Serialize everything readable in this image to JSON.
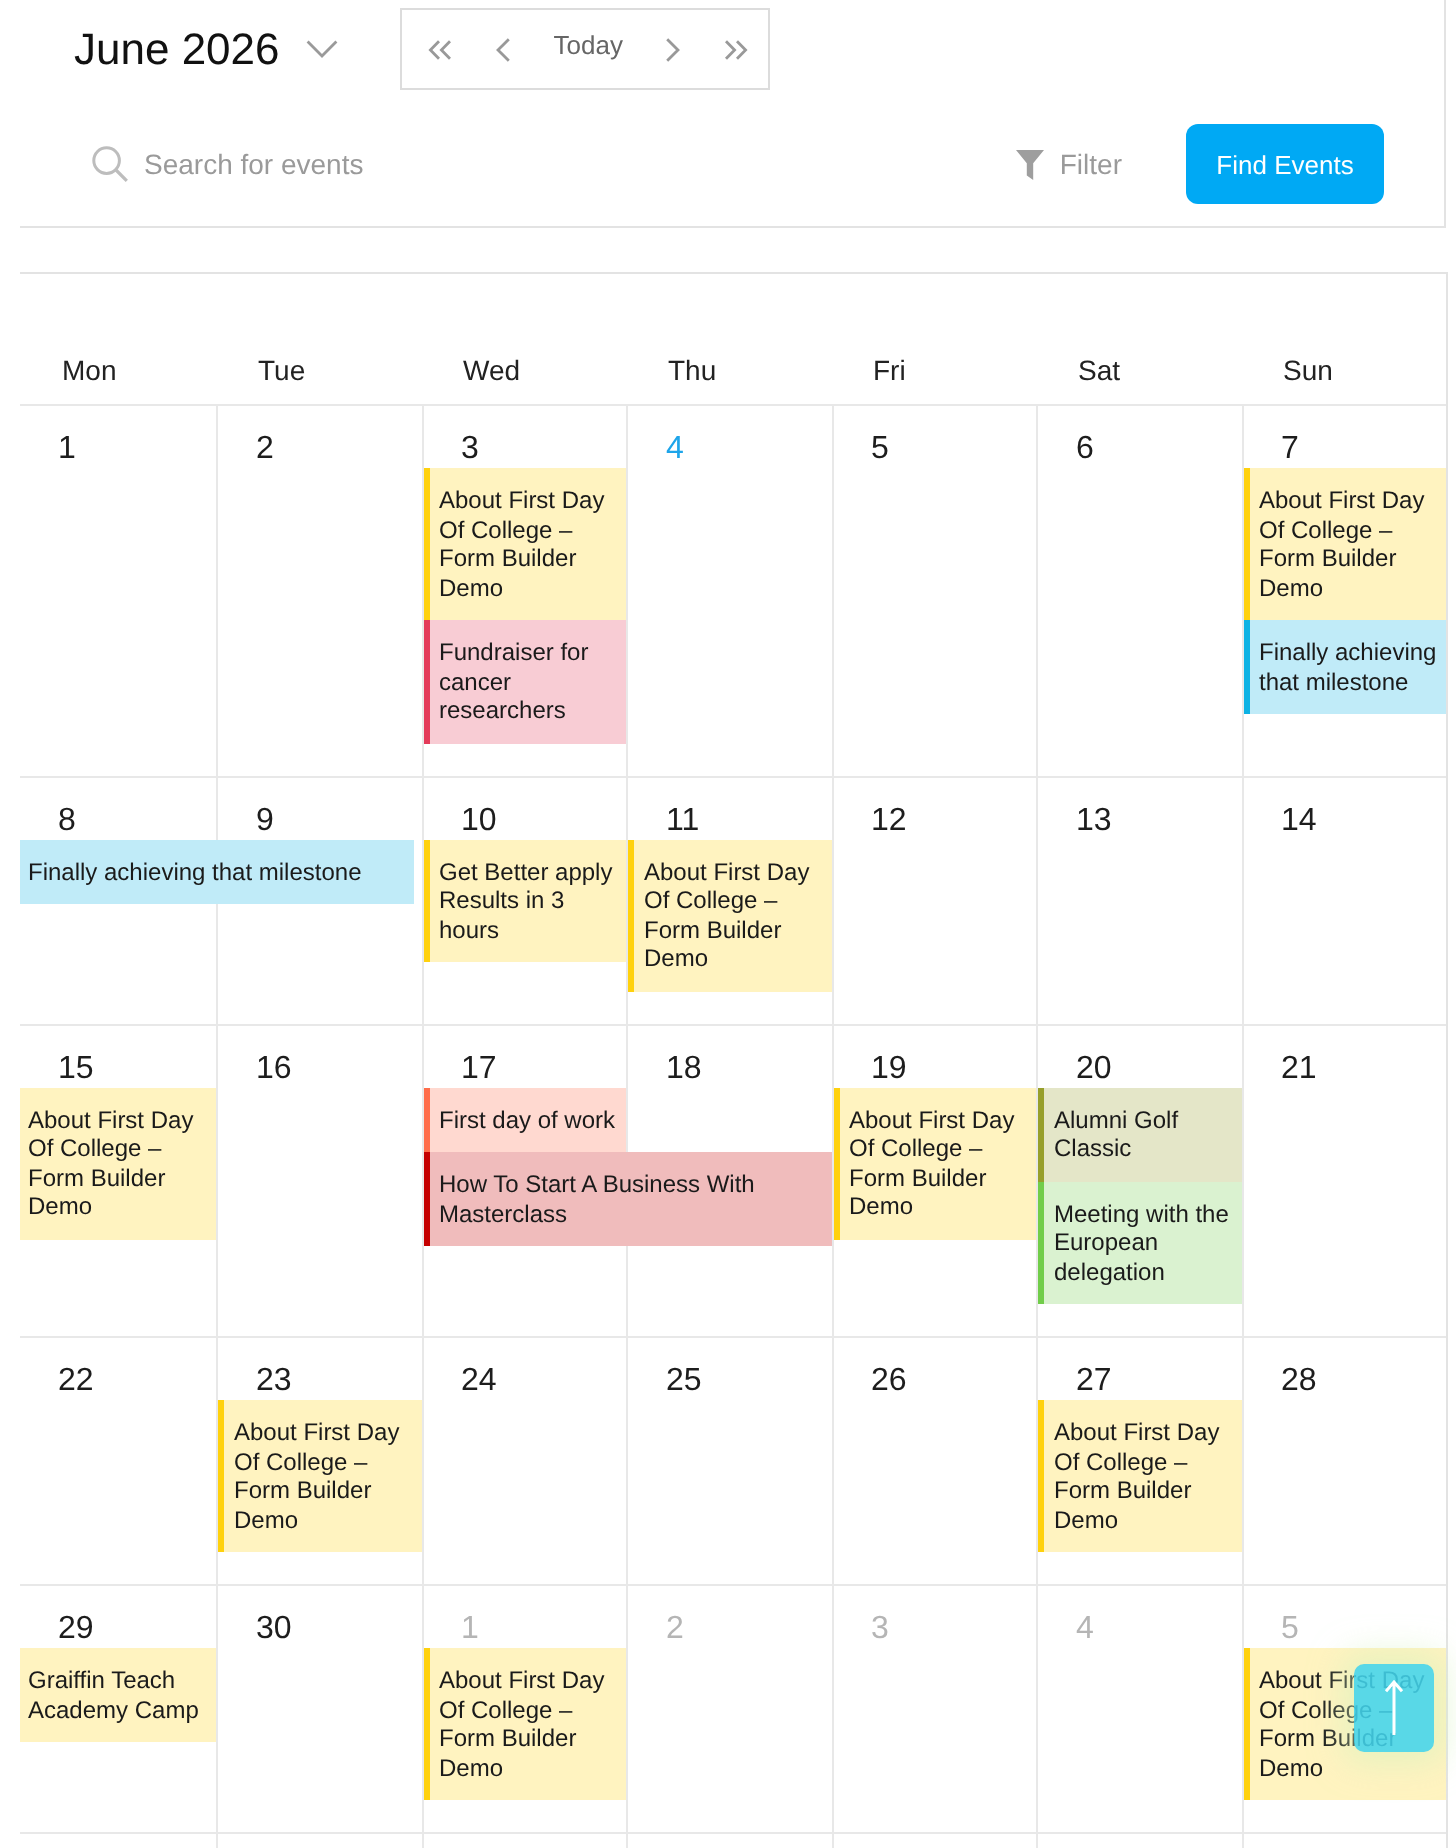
{
  "header": {
    "month_label": "June 2026",
    "today_button": "Today",
    "search": {
      "placeholder": "Search for events"
    },
    "filter_label": "Filter",
    "find_button": "Find Events"
  },
  "calendar": {
    "weekdays": [
      "Mon",
      "Tue",
      "Wed",
      "Thu",
      "Fri",
      "Sat",
      "Sun"
    ],
    "weeks": [
      {
        "days": [
          {
            "number": "1",
            "kind": "in-month"
          },
          {
            "number": "2",
            "kind": "in-month"
          },
          {
            "number": "3",
            "kind": "in-month",
            "events": [
              {
                "title": "About First Day Of College – Form Builder Demo",
                "color": "#fff3c0",
                "kind": "single-day"
              },
              {
                "title": "Fundraiser for cancer researchers",
                "color": "#f8ccd4",
                "kind": "single-day"
              }
            ]
          },
          {
            "number": "4",
            "kind": "today"
          },
          {
            "number": "5",
            "kind": "in-month"
          },
          {
            "number": "6",
            "kind": "in-month"
          },
          {
            "number": "7",
            "kind": "in-month",
            "events": [
              {
                "title": "About First Day Of College – Form Builder Demo",
                "color": "#fff3c0",
                "kind": "single-day"
              },
              {
                "title": "Finally achieving that milestone",
                "color": "#c0ebf8",
                "kind": "single-day"
              }
            ]
          }
        ]
      },
      {
        "days": [
          {
            "number": "8",
            "kind": "in-month",
            "events": [
              {
                "title": "Finally achieving that milestone",
                "color": "#c0ebf8",
                "kind": "two-day"
              }
            ]
          },
          {
            "number": "9",
            "kind": "in-month"
          },
          {
            "number": "10",
            "kind": "in-month",
            "events": [
              {
                "title": "Get Better apply Results in 3 hours",
                "color": "#fff3c0",
                "kind": "single-day"
              }
            ]
          },
          {
            "number": "11",
            "kind": "in-month",
            "events": [
              {
                "title": "About First Day Of College – Form Builder Demo",
                "color": "#fff3c0",
                "kind": "single-day"
              }
            ]
          },
          {
            "number": "12",
            "kind": "in-month"
          },
          {
            "number": "13",
            "kind": "in-month"
          },
          {
            "number": "14",
            "kind": "in-month"
          }
        ]
      },
      {
        "days": [
          {
            "number": "15",
            "kind": "in-month",
            "events": [
              {
                "title": "About First Day Of College – Form Builder Demo",
                "color": "#fff3c0",
                "kind": "single-day"
              }
            ]
          },
          {
            "number": "16",
            "kind": "in-month"
          },
          {
            "number": "17",
            "kind": "in-month",
            "events": [
              {
                "title": "First day of work",
                "color": "#ffd9d0",
                "kind": "single-day"
              },
              {
                "title": "How To Start A Business With Masterclass",
                "color": "#f0bcbc",
                "kind": "two-day"
              }
            ]
          },
          {
            "number": "18",
            "kind": "in-month"
          },
          {
            "number": "19",
            "kind": "in-month",
            "events": [
              {
                "title": "About First Day Of College – Form Builder Demo",
                "color": "#fff3c0",
                "kind": "single-day"
              }
            ]
          },
          {
            "number": "20",
            "kind": "in-month",
            "events": [
              {
                "title": "Alumni Golf Classic",
                "color": "#e4e6c8",
                "kind": "single-day"
              },
              {
                "title": "Meeting with the European delegation",
                "color": "#daf2d0",
                "kind": "single-day"
              }
            ]
          },
          {
            "number": "21",
            "kind": "in-month"
          }
        ]
      },
      {
        "days": [
          {
            "number": "22",
            "kind": "in-month"
          },
          {
            "number": "23",
            "kind": "in-month",
            "events": [
              {
                "title": "About First Day Of College – Form Builder Demo",
                "color": "#fff3c0",
                "kind": "single-day"
              }
            ]
          },
          {
            "number": "24",
            "kind": "in-month"
          },
          {
            "number": "25",
            "kind": "in-month"
          },
          {
            "number": "26",
            "kind": "in-month"
          },
          {
            "number": "27",
            "kind": "in-month",
            "events": [
              {
                "title": "About First Day Of College – Form Builder Demo",
                "color": "#fff3c0",
                "kind": "single-day"
              }
            ]
          },
          {
            "number": "28",
            "kind": "in-month"
          }
        ]
      },
      {
        "days": [
          {
            "number": "29",
            "kind": "in-month",
            "events": [
              {
                "title": "Graiffin Teach Academy Camp",
                "color": "#fff3c0",
                "kind": "single-day"
              }
            ]
          },
          {
            "number": "30",
            "kind": "in-month"
          },
          {
            "number": "1",
            "kind": "other-month",
            "events": [
              {
                "title": "About First Day Of College – Form Builder Demo",
                "color": "#fff3c0",
                "kind": "single-day"
              }
            ]
          },
          {
            "number": "2",
            "kind": "other-month"
          },
          {
            "number": "3",
            "kind": "other-month"
          },
          {
            "number": "4",
            "kind": "other-month"
          },
          {
            "number": "5",
            "kind": "other-month",
            "events": [
              {
                "title": "About First Day Of College – Form Builder Demo",
                "color": "#fff3c0",
                "kind": "single-day"
              }
            ]
          }
        ]
      }
    ]
  }
}
